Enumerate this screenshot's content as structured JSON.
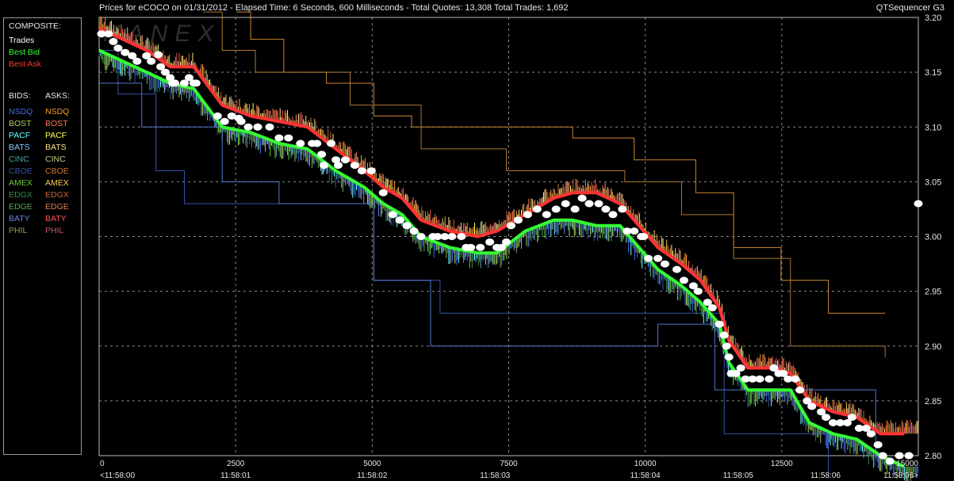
{
  "header": {
    "title": "Prices for  eCOCO  on  01/31/2012  -  Elapsed Time: 6 Seconds, 600 Milliseconds  -  Total Quotes: 13,308  Total Trades: 1,692",
    "brand": "QTSequencer G3"
  },
  "watermark": "NANEX",
  "legend": {
    "composite_label": "COMPOSITE:",
    "composite": [
      {
        "label": "Trades",
        "color": "#ffffff"
      },
      {
        "label": "Best Bid",
        "color": "#33ff33"
      },
      {
        "label": "Best Ask",
        "color": "#ff3333"
      }
    ],
    "bids_label": "BIDS:",
    "asks_label": "ASKS:",
    "exchanges": [
      {
        "bid": "NSDQ",
        "bid_color": "#3b6cf0",
        "ask": "NSDQ",
        "ask_color": "#ff9a2e"
      },
      {
        "bid": "BOST",
        "bid_color": "#a8d060",
        "ask": "BOST",
        "ask_color": "#ff7755"
      },
      {
        "bid": "PACF",
        "bid_color": "#66ffff",
        "ask": "PACF",
        "ask_color": "#ffff55"
      },
      {
        "bid": "BATS",
        "bid_color": "#88ccff",
        "ask": "BATS",
        "ask_color": "#ffdd88"
      },
      {
        "bid": "CINC",
        "bid_color": "#4aa8a8",
        "ask": "CINC",
        "ask_color": "#cccc88"
      },
      {
        "bid": "CBOE",
        "bid_color": "#3355aa",
        "ask": "CBOE",
        "ask_color": "#cc7733"
      },
      {
        "bid": "AMEX",
        "bid_color": "#66cc33",
        "ask": "AMEX",
        "ask_color": "#ffcc55"
      },
      {
        "bid": "EDGX",
        "bid_color": "#2f8f4f",
        "ask": "EDGX",
        "ask_color": "#cc6633"
      },
      {
        "bid": "EDGE",
        "bid_color": "#55aa55",
        "ask": "EDGE",
        "ask_color": "#dd8855"
      },
      {
        "bid": "BATY",
        "bid_color": "#6688dd",
        "ask": "BATY",
        "ask_color": "#ff5555"
      },
      {
        "bid": "PHIL",
        "bid_color": "#88aa55",
        "ask": "PHIL",
        "ask_color": "#cc5566"
      }
    ]
  },
  "chart_data": {
    "type": "scatter",
    "x_unit": "milliseconds",
    "xlim": [
      0,
      15000
    ],
    "ylim": [
      2.8,
      3.2
    ],
    "grid": true,
    "x_ticks": [
      0,
      2500,
      5000,
      7500,
      10000,
      12500,
      15000
    ],
    "x_tick_labels": [
      "0",
      "2500",
      "5000",
      "7500",
      "10000",
      "12500",
      "15000"
    ],
    "time_labels": [
      {
        "x": 0,
        "label": "<11:58:00"
      },
      {
        "x": 2500,
        "label": "11:58:01"
      },
      {
        "x": 5000,
        "label": "11:58:02"
      },
      {
        "x": 7250,
        "label": "11:58:03"
      },
      {
        "x": 10000,
        "label": "11:58:04"
      },
      {
        "x": 11700,
        "label": "11:58:05"
      },
      {
        "x": 13300,
        "label": "11:58:06"
      },
      {
        "x": 15000,
        "label": "11:58:06>"
      }
    ],
    "y_ticks": [
      2.8,
      2.85,
      2.9,
      2.95,
      3.0,
      3.05,
      3.1,
      3.15,
      3.2
    ],
    "y_tick_labels": [
      "2.80",
      "2.85",
      "2.90",
      "2.95",
      "3.00",
      "3.05",
      "3.10",
      "3.15",
      "3.20"
    ],
    "series": [
      {
        "name": "Trades",
        "color": "#ffffff",
        "points": [
          [
            50,
            3.185
          ],
          [
            200,
            3.185
          ],
          [
            300,
            3.178
          ],
          [
            400,
            3.172
          ],
          [
            550,
            3.168
          ],
          [
            700,
            3.165
          ],
          [
            800,
            3.16
          ],
          [
            1000,
            3.165
          ],
          [
            1100,
            3.16
          ],
          [
            1250,
            3.166
          ],
          [
            1300,
            3.155
          ],
          [
            1400,
            3.15
          ],
          [
            1500,
            3.145
          ],
          [
            1550,
            3.14
          ],
          [
            1600,
            3.14
          ],
          [
            1800,
            3.14
          ],
          [
            1900,
            3.145
          ],
          [
            2000,
            3.14
          ],
          [
            2050,
            3.14
          ],
          [
            2500,
            3.11
          ],
          [
            2650,
            3.105
          ],
          [
            2800,
            3.11
          ],
          [
            2950,
            3.108
          ],
          [
            3000,
            3.105
          ],
          [
            3150,
            3.1
          ],
          [
            3350,
            3.1
          ],
          [
            3600,
            3.1
          ],
          [
            3800,
            3.09
          ],
          [
            4000,
            3.09
          ],
          [
            4250,
            3.085
          ],
          [
            4500,
            3.085
          ],
          [
            4600,
            3.085
          ],
          [
            4700,
            3.075
          ],
          [
            4750,
            3.065
          ],
          [
            4900,
            3.085
          ],
          [
            5000,
            3.07
          ],
          [
            5050,
            3.065
          ],
          [
            5200,
            3.07
          ],
          [
            5400,
            3.065
          ],
          [
            5550,
            3.06
          ],
          [
            5750,
            3.06
          ],
          [
            6000,
            3.04
          ],
          [
            6200,
            3.02
          ],
          [
            6350,
            3.015
          ],
          [
            6500,
            3.01
          ],
          [
            6650,
            3.005
          ],
          [
            6800,
            3.0
          ],
          [
            7050,
            3.0
          ],
          [
            7150,
            3.0
          ],
          [
            7300,
            3.0
          ],
          [
            7450,
            3.0
          ],
          [
            7650,
            3.0
          ],
          [
            7750,
            2.99
          ],
          [
            7850,
            2.99
          ],
          [
            8050,
            2.99
          ],
          [
            8250,
            2.995
          ],
          [
            8400,
            2.99
          ],
          [
            8500,
            2.99
          ],
          [
            8600,
            2.995
          ],
          [
            8700,
            3.01
          ],
          [
            8850,
            3.015
          ],
          [
            9050,
            3.02
          ],
          [
            9250,
            3.025
          ],
          [
            9450,
            3.02
          ],
          [
            9650,
            3.025
          ],
          [
            9850,
            3.03
          ],
          [
            10050,
            3.025
          ],
          [
            10200,
            3.035
          ],
          [
            10350,
            3.03
          ],
          [
            10550,
            3.03
          ],
          [
            10700,
            3.025
          ],
          [
            10850,
            3.02
          ],
          [
            11050,
            3.025
          ],
          [
            11150,
            3.005
          ],
          [
            11300,
            3.005
          ],
          [
            11450,
            3.0
          ],
          [
            11500,
            3.0
          ],
          [
            11600,
            2.98
          ],
          [
            11800,
            2.98
          ],
          [
            11950,
            2.975
          ],
          [
            12200,
            2.97
          ],
          [
            12350,
            2.96
          ],
          [
            12550,
            2.955
          ],
          [
            12650,
            2.95
          ],
          [
            12850,
            2.94
          ],
          [
            12950,
            2.935
          ],
          [
            13100,
            2.92
          ],
          [
            13200,
            2.91
          ],
          [
            13250,
            2.9
          ],
          [
            13300,
            2.89
          ],
          [
            13350,
            2.875
          ],
          [
            13450,
            2.875
          ],
          [
            13550,
            2.88
          ],
          [
            13650,
            2.87
          ],
          [
            13800,
            2.87
          ],
          [
            13950,
            2.87
          ],
          [
            14150,
            2.87
          ],
          [
            14250,
            2.88
          ],
          [
            14350,
            2.875
          ],
          [
            14450,
            2.875
          ],
          [
            14550,
            2.87
          ],
          [
            14700,
            2.87
          ],
          [
            14800,
            2.86
          ],
          [
            14950,
            2.85
          ],
          [
            15050,
            2.845
          ],
          [
            15250,
            2.84
          ],
          [
            15350,
            2.835
          ],
          [
            15500,
            2.83
          ],
          [
            15650,
            2.83
          ],
          [
            15800,
            2.83
          ],
          [
            15900,
            2.835
          ],
          [
            16050,
            2.825
          ],
          [
            16200,
            2.825
          ],
          [
            16300,
            2.82
          ],
          [
            16450,
            2.81
          ],
          [
            16550,
            2.8
          ],
          [
            16700,
            2.795
          ],
          [
            16900,
            2.8
          ],
          [
            17100,
            2.8
          ],
          [
            17300,
            3.03
          ]
        ]
      },
      {
        "name": "Best Bid",
        "color": "#33ff33",
        "points": [
          [
            0,
            3.17
          ],
          [
            500,
            3.16
          ],
          [
            1000,
            3.15
          ],
          [
            1500,
            3.14
          ],
          [
            2000,
            3.135
          ],
          [
            2600,
            3.1
          ],
          [
            3200,
            3.095
          ],
          [
            3800,
            3.085
          ],
          [
            4400,
            3.08
          ],
          [
            5000,
            3.06
          ],
          [
            5600,
            3.045
          ],
          [
            6000,
            3.03
          ],
          [
            6400,
            3.02
          ],
          [
            6800,
            3.0
          ],
          [
            7400,
            2.99
          ],
          [
            8000,
            2.985
          ],
          [
            8400,
            2.985
          ],
          [
            9000,
            3.005
          ],
          [
            9600,
            3.015
          ],
          [
            10000,
            3.015
          ],
          [
            10500,
            3.01
          ],
          [
            11000,
            3.01
          ],
          [
            11400,
            2.99
          ],
          [
            11800,
            2.97
          ],
          [
            12300,
            2.955
          ],
          [
            12700,
            2.94
          ],
          [
            13100,
            2.92
          ],
          [
            13300,
            2.885
          ],
          [
            13700,
            2.86
          ],
          [
            14200,
            2.86
          ],
          [
            14600,
            2.86
          ],
          [
            15000,
            2.83
          ],
          [
            15500,
            2.82
          ],
          [
            16000,
            2.815
          ],
          [
            16500,
            2.8
          ],
          [
            17000,
            2.79
          ]
        ]
      },
      {
        "name": "Best Ask",
        "color": "#ff3333",
        "points": [
          [
            0,
            3.19
          ],
          [
            500,
            3.18
          ],
          [
            1000,
            3.17
          ],
          [
            1500,
            3.155
          ],
          [
            2000,
            3.155
          ],
          [
            2600,
            3.12
          ],
          [
            3200,
            3.11
          ],
          [
            3800,
            3.105
          ],
          [
            4400,
            3.1
          ],
          [
            5000,
            3.08
          ],
          [
            5600,
            3.06
          ],
          [
            6000,
            3.045
          ],
          [
            6400,
            3.035
          ],
          [
            6800,
            3.015
          ],
          [
            7400,
            3.005
          ],
          [
            8000,
            3.0
          ],
          [
            8400,
            3.005
          ],
          [
            9000,
            3.02
          ],
          [
            9600,
            3.035
          ],
          [
            10000,
            3.04
          ],
          [
            10500,
            3.04
          ],
          [
            11000,
            3.03
          ],
          [
            11400,
            3.01
          ],
          [
            11800,
            2.99
          ],
          [
            12300,
            2.975
          ],
          [
            12700,
            2.96
          ],
          [
            13100,
            2.935
          ],
          [
            13300,
            2.905
          ],
          [
            13700,
            2.88
          ],
          [
            14200,
            2.88
          ],
          [
            14600,
            2.875
          ],
          [
            15000,
            2.85
          ],
          [
            15500,
            2.84
          ],
          [
            16000,
            2.835
          ],
          [
            16500,
            2.82
          ],
          [
            17000,
            2.82
          ]
        ]
      }
    ]
  }
}
